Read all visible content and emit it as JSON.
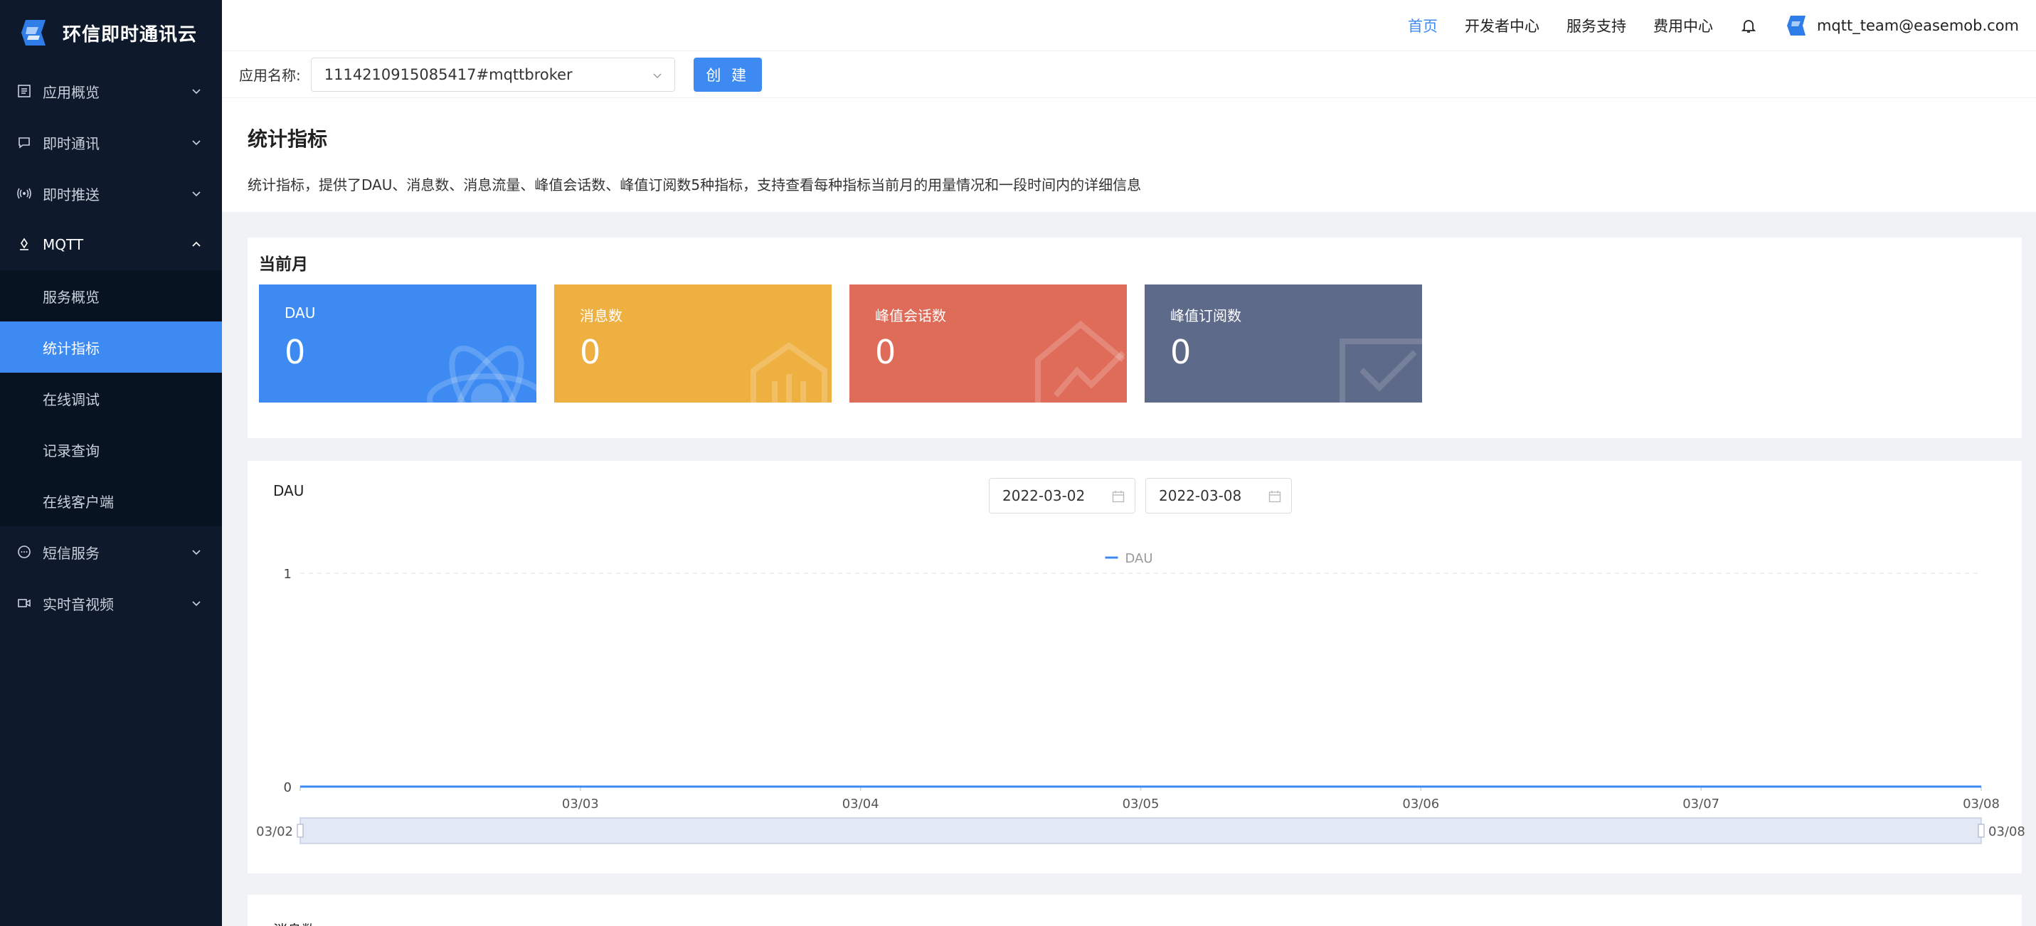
{
  "brand": {
    "name": "环信即时通讯云"
  },
  "sidebar": {
    "items": [
      {
        "label": "应用概览",
        "icon": "list-icon"
      },
      {
        "label": "即时通讯",
        "icon": "chat-icon"
      },
      {
        "label": "即时推送",
        "icon": "broadcast-icon"
      },
      {
        "label": "MQTT",
        "icon": "mqtt-icon"
      },
      {
        "label": "短信服务",
        "icon": "sms-icon"
      },
      {
        "label": "实时音视频",
        "icon": "video-icon"
      }
    ],
    "mqtt_sub": [
      {
        "label": "服务概览"
      },
      {
        "label": "统计指标"
      },
      {
        "label": "在线调试"
      },
      {
        "label": "记录查询"
      },
      {
        "label": "在线客户端"
      }
    ]
  },
  "header": {
    "links": [
      "首页",
      "开发者中心",
      "服务支持",
      "费用中心"
    ],
    "user": "mqtt_team@easemob.com"
  },
  "appbar": {
    "label": "应用名称:",
    "app_value": "1114210915085417#mqttbroker",
    "create_label": "创 建"
  },
  "intro": {
    "title": "统计指标",
    "desc": "统计指标，提供了DAU、消息数、消息流量、峰值会话数、峰值订阅数5种指标，支持查看每种指标当前月的用量情况和一段时间内的详细信息"
  },
  "current_month": {
    "title": "当前月",
    "stats": [
      {
        "label": "DAU",
        "value": "0",
        "color": "#3d8bf2"
      },
      {
        "label": "消息数",
        "value": "0",
        "color": "#efb042"
      },
      {
        "label": "峰值会话数",
        "value": "0",
        "color": "#df6b59"
      },
      {
        "label": "峰值订阅数",
        "value": "0",
        "color": "#5e6a89"
      }
    ]
  },
  "chart_card": {
    "title": "DAU",
    "start_date": "2022-03-02",
    "end_date": "2022-03-08"
  },
  "chart_data": {
    "type": "line",
    "x": [
      "03/02",
      "03/03",
      "03/04",
      "03/05",
      "03/06",
      "03/07",
      "03/08"
    ],
    "x_tick_labels": [
      "03/03",
      "03/04",
      "03/05",
      "03/06",
      "03/07",
      "03/08"
    ],
    "series": [
      {
        "name": "DAU",
        "values": [
          0,
          0,
          0,
          0,
          0,
          0,
          0
        ]
      }
    ],
    "y_ticks": [
      "0",
      "1"
    ],
    "ylim": [
      0,
      1
    ],
    "legend": "top-center",
    "grid": true,
    "slider_labels": [
      "03/02",
      "03/08"
    ],
    "line_color": "#3d8bf2"
  },
  "next_card": {
    "title": "消息数"
  }
}
